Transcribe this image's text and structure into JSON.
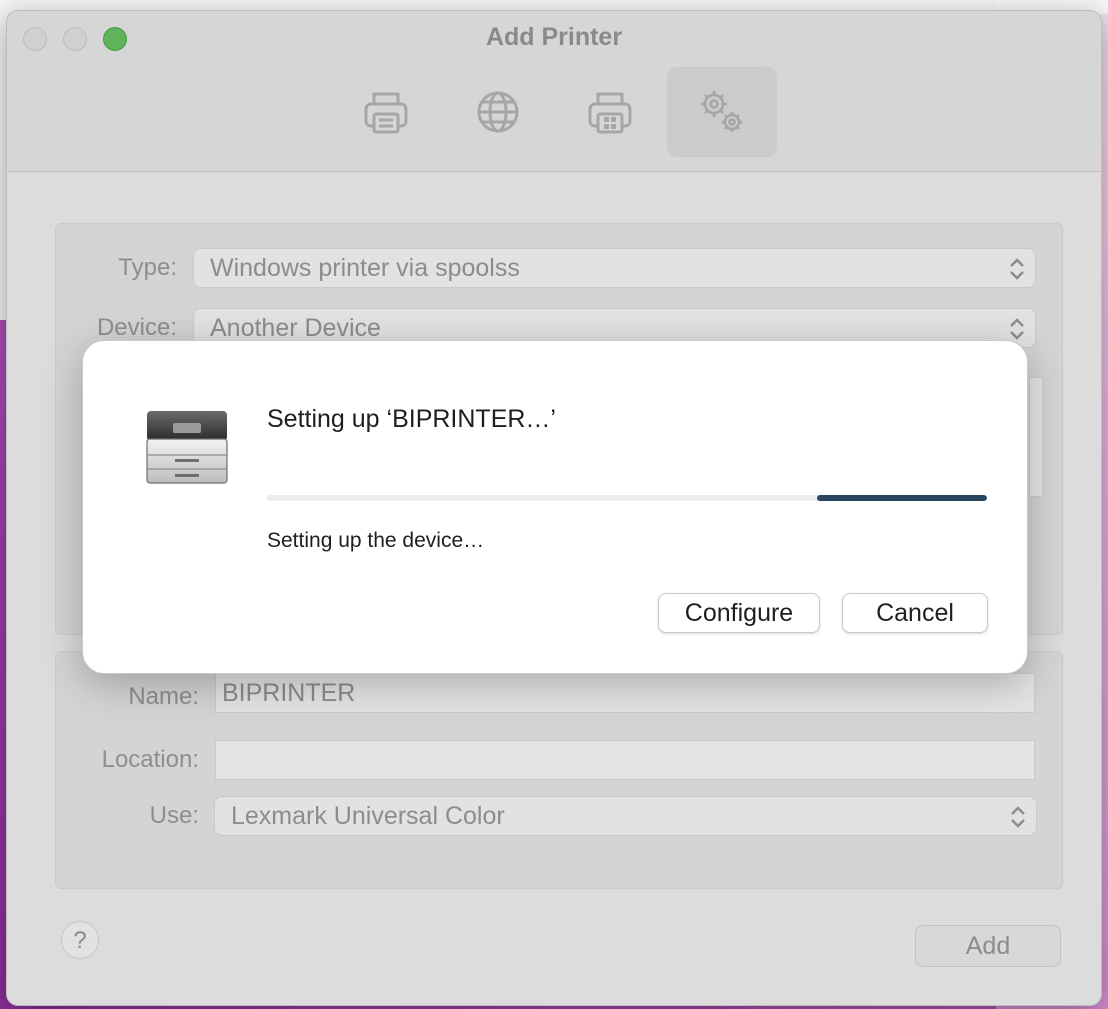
{
  "window": {
    "title": "Add Printer",
    "toolbar": [
      {
        "icon": "default-printer-icon",
        "selected": false
      },
      {
        "icon": "ip-globe-icon",
        "selected": false
      },
      {
        "icon": "windows-printer-icon",
        "selected": false
      },
      {
        "icon": "advanced-gears-icon",
        "selected": true
      }
    ]
  },
  "form": {
    "type_label": "Type:",
    "type_value": "Windows printer via spoolss",
    "device_label": "Device:",
    "device_value": "Another Device",
    "name_label": "Name:",
    "name_value": "BIPRINTER",
    "location_label": "Location:",
    "location_value": "",
    "use_label": "Use:",
    "use_value": "Lexmark Universal Color"
  },
  "footer": {
    "help_label": "?",
    "add_label": "Add"
  },
  "sheet": {
    "icon": "printer-icon",
    "title": "Setting up ‘BIPRINTER…’",
    "status": "Setting up the device…",
    "progress_indeterminate": true,
    "configure_label": "Configure",
    "cancel_label": "Cancel",
    "accent_color": "#29465e"
  }
}
